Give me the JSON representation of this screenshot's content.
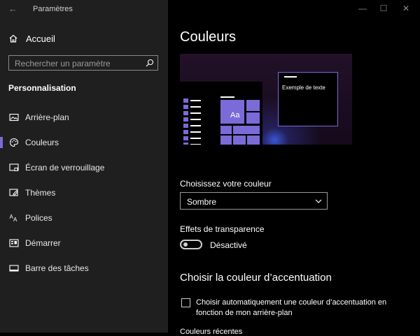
{
  "app": {
    "title": "Paramètres"
  },
  "sidebar": {
    "home_label": "Accueil",
    "search_placeholder": "Rechercher un paramètre",
    "section_title": "Personnalisation",
    "items": [
      {
        "label": "Arrière-plan",
        "icon": "picture-icon",
        "active": false
      },
      {
        "label": "Couleurs",
        "icon": "palette-icon",
        "active": true
      },
      {
        "label": "Écran de verrouillage",
        "icon": "lock-screen-icon",
        "active": false
      },
      {
        "label": "Thèmes",
        "icon": "themes-icon",
        "active": false
      },
      {
        "label": "Polices",
        "icon": "fonts-icon",
        "active": false
      },
      {
        "label": "Démarrer",
        "icon": "start-icon",
        "active": false
      },
      {
        "label": "Barre des tâches",
        "icon": "taskbar-icon",
        "active": false
      }
    ]
  },
  "main": {
    "title": "Couleurs",
    "preview": {
      "tile_text": "Aa",
      "sample_text": "Exemple de texte"
    },
    "color_label": "Choisissez votre couleur",
    "color_value": "Sombre",
    "transparency_label": "Effets de transparence",
    "transparency_state": "Désactivé",
    "accent_title": "Choisir la couleur d’accentuation",
    "auto_accent_label": "Choisir automatiquement une couleur d’accentuation en fonction de mon arrière-plan",
    "cut_text": "Couleurs récentes"
  },
  "colors": {
    "accent": "#7a6bd8",
    "sidebar_bg": "#1f1f1f",
    "main_bg": "#000000"
  }
}
